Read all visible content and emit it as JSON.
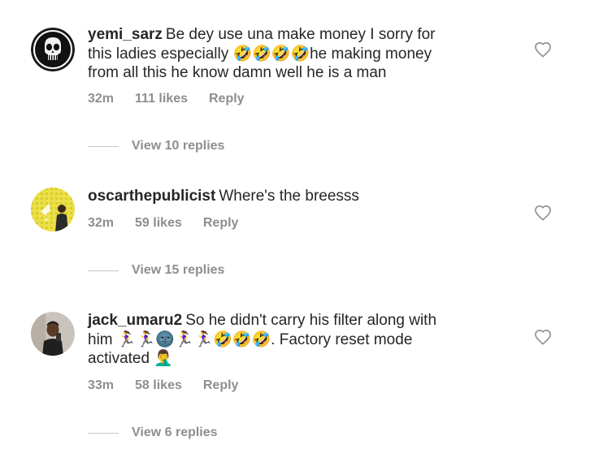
{
  "comments": [
    {
      "username": "yemi_sarz",
      "text_lines": [
        "Be dey use una make money I sorry for",
        "this ladies especially 🤣🤣🤣🤣he making money",
        "from all this he know damn well he is a man"
      ],
      "time": "32m",
      "likes": "111 likes",
      "reply_label": "Reply",
      "view_replies": "View 10 replies"
    },
    {
      "username": "oscarthepublicist",
      "text_lines": [
        "Where's the breesss"
      ],
      "time": "32m",
      "likes": "59 likes",
      "reply_label": "Reply",
      "view_replies": "View 15 replies"
    },
    {
      "username": "jack_umaru2",
      "text_lines": [
        "So he didn't carry his filter along with",
        "him 🏃‍♀️🏃‍♀️🌚🏃‍♀️🏃‍♀️🤣🤣🤣. Factory reset mode",
        "activated 🤦‍♂️"
      ],
      "time": "33m",
      "likes": "58 likes",
      "reply_label": "Reply",
      "view_replies": "View 6 replies"
    }
  ],
  "icons": {
    "like": "heart-outline-icon"
  },
  "colors": {
    "text": "#262626",
    "secondary": "#8e8e8e",
    "divider": "#c7c7c7"
  }
}
